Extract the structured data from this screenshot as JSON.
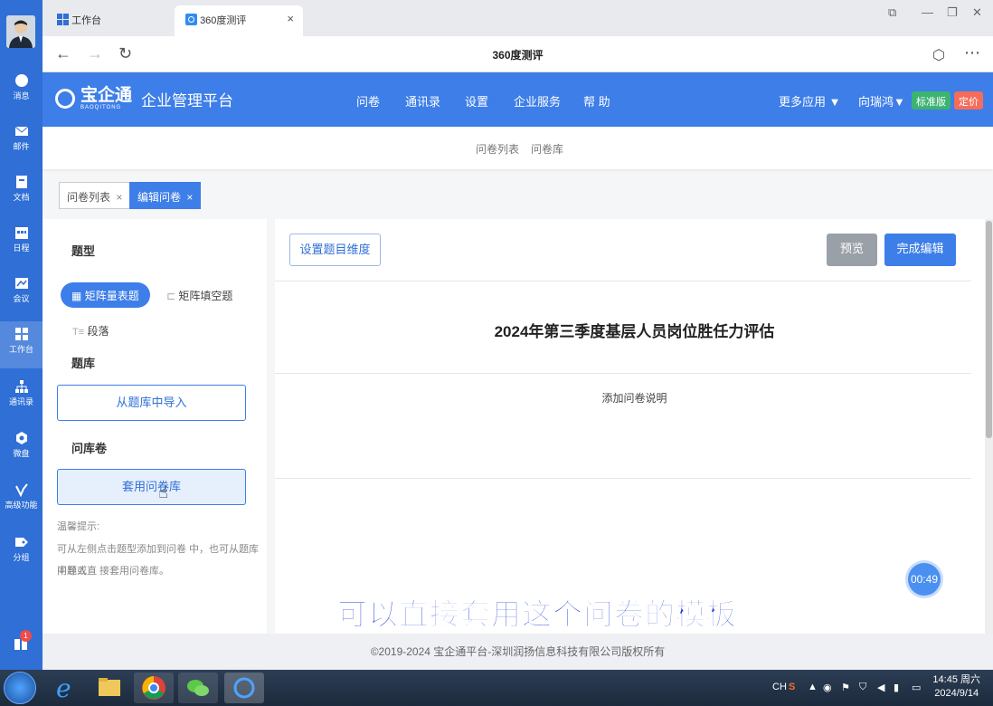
{
  "browser": {
    "tabs": [
      {
        "label": "工作台"
      },
      {
        "label": "360度测评"
      }
    ],
    "page_title": "360度测评"
  },
  "rail": {
    "items": [
      {
        "label": "消息",
        "icon": "chat-icon"
      },
      {
        "label": "邮件",
        "icon": "mail-icon"
      },
      {
        "label": "文档",
        "icon": "document-icon"
      },
      {
        "label": "日程",
        "icon": "calendar-icon"
      },
      {
        "label": "会议",
        "icon": "meeting-icon"
      },
      {
        "label": "工作台",
        "icon": "grid-icon",
        "active": true
      },
      {
        "label": "通讯录",
        "icon": "org-chart-icon"
      },
      {
        "label": "微盘",
        "icon": "drive-icon"
      },
      {
        "label": "高级功能",
        "icon": "advanced-icon"
      },
      {
        "label": "分组",
        "icon": "tag-icon"
      }
    ],
    "notification_count": "1"
  },
  "header": {
    "logo_text": "宝企通",
    "logo_sub": "BAOQITONG",
    "platform": "企业管理平台",
    "nav": [
      "问卷",
      "通讯录",
      "设置",
      "企业服务",
      "帮 助"
    ],
    "more_apps": "更多应用",
    "user": "向瑞鸿",
    "badge_standard": "标准版",
    "badge_price": "定价",
    "accent": "#3d7ee8"
  },
  "subnav": {
    "items": [
      "问卷列表",
      "问卷库"
    ]
  },
  "page_tabs": [
    {
      "label": "问卷列表",
      "close": "×"
    },
    {
      "label": "编辑问卷",
      "close": "×",
      "active": true
    }
  ],
  "left_panel": {
    "section_type": "题型",
    "type_matrix_scale": "矩阵量表题",
    "type_matrix_fill": "矩阵填空题",
    "type_paragraph": "段落",
    "section_bank": "题库",
    "import_button": "从题库中导入",
    "section_template": "问库卷",
    "template_button": "套用问卷库",
    "tip_title": "温馨提示:",
    "tip_line1": "可从左侧点击题型添加到问卷 中，也可从题库中导入",
    "tip_line2": "问题或直 接套用问卷库。"
  },
  "main": {
    "dimension_button": "设置题目维度",
    "preview_button": "预览",
    "finish_button": "完成编辑",
    "title": "2024年第三季度基层人员岗位胜任力评估",
    "description": "添加问卷说明"
  },
  "timer": "00:49",
  "caption": "可以直接套用这个问卷的模板",
  "footer": "©2019-2024 宝企通平台-深圳润扬信息科技有限公司版权所有",
  "taskbar": {
    "lang": "CH",
    "time": "14:45 周六",
    "date": "2024/9/14"
  }
}
